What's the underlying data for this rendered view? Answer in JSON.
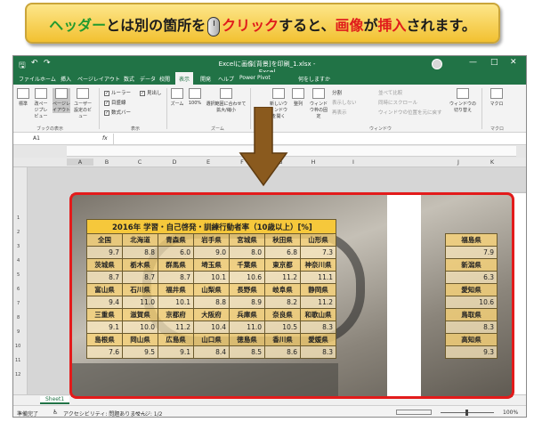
{
  "callout": {
    "part1": "ヘッダー",
    "part2": "とは別の箇所を",
    "part3": "クリック",
    "part4": "すると、",
    "part5": "画像",
    "part6": "が",
    "part7": "挿入",
    "part8": "されます。",
    "mouse_icon": "mouse-icon"
  },
  "window": {
    "title": "Excelに画像[背景]を印刷_1.xlsx - Excel",
    "qat": {
      "save": "🖫",
      "undo": "↶",
      "redo": "↷"
    },
    "controls": {
      "min": "—",
      "max": "□",
      "close": "✕"
    }
  },
  "tabs": [
    "ファイル",
    "ホーム",
    "挿入",
    "ページレイアウト",
    "数式",
    "データ",
    "校閲",
    "表示",
    "開発",
    "ヘルプ",
    "Power Pivot",
    "何をしますか"
  ],
  "active_tab_index": 7,
  "ribbon": {
    "view_buttons": [
      "標準",
      "改ページプレビュー",
      "ページレイアウト",
      "ユーザー設定のビュー"
    ],
    "group_book_views": "ブックの表示",
    "checks": [
      {
        "label": "ルーラー",
        "checked": true
      },
      {
        "label": "目盛線",
        "checked": true
      },
      {
        "label": "数式バー",
        "checked": true
      },
      {
        "label": "見出し",
        "checked": true
      }
    ],
    "group_show": "表示",
    "zoom_buttons": [
      "ズーム",
      "100%",
      "選択範囲に合わせて拡大/縮小"
    ],
    "group_zoom": "ズーム",
    "window_buttons": [
      "新しいウィンドウを開く",
      "整列",
      "ウィンドウ枠の固定"
    ],
    "window_small": [
      "分割",
      "表示しない",
      "再表示",
      "並べて比較",
      "同時にスクロール",
      "ウィンドウの位置を元に戻す"
    ],
    "switch_window": "ウィンドウの切り替え",
    "group_window": "ウィンドウ",
    "macro": "マクロ",
    "group_macro": "マクロ"
  },
  "formula_bar": {
    "cell_ref": "A1",
    "fx": "fx"
  },
  "columns": [
    "A",
    "B",
    "C",
    "D",
    "E",
    "F",
    "G",
    "H",
    "I",
    "J",
    "K"
  ],
  "rows": [
    "1",
    "2",
    "3",
    "4",
    "5",
    "6",
    "7",
    "8",
    "9",
    "10",
    "11",
    "12",
    "13",
    "14"
  ],
  "sheet_tab": "Sheet1",
  "status": {
    "ready": "準備完了",
    "accessibility": "アクセシビリティ: 問題ありません",
    "page": "ページ: 1/2",
    "zoom": "100%"
  },
  "table": {
    "title": "2016年 学習・自己啓発・訓練行動者率（10歳以上）[%]",
    "blocks": [
      {
        "prefs": [
          "全国",
          "北海道",
          "青森県",
          "岩手県",
          "宮城県",
          "秋田県",
          "山形県"
        ],
        "values": [
          "9.7",
          "8.8",
          "6.0",
          "9.0",
          "8.0",
          "6.8",
          "7.3"
        ]
      },
      {
        "prefs": [
          "茨城県",
          "栃木県",
          "群馬県",
          "埼玉県",
          "千葉県",
          "東京都",
          "神奈川県"
        ],
        "values": [
          "8.7",
          "8.7",
          "8.7",
          "10.1",
          "10.6",
          "11.2",
          "11.1"
        ]
      },
      {
        "prefs": [
          "富山県",
          "石川県",
          "福井県",
          "山梨県",
          "長野県",
          "岐阜県",
          "静岡県"
        ],
        "values": [
          "9.4",
          "11.0",
          "10.1",
          "8.8",
          "8.9",
          "8.2",
          "11.2"
        ]
      },
      {
        "prefs": [
          "三重県",
          "滋賀県",
          "京都府",
          "大阪府",
          "兵庫県",
          "奈良県",
          "和歌山県"
        ],
        "values": [
          "9.1",
          "10.0",
          "11.2",
          "10.4",
          "11.0",
          "10.5",
          "8.3"
        ]
      },
      {
        "prefs": [
          "島根県",
          "岡山県",
          "広島県",
          "山口県",
          "徳島県",
          "香川県",
          "愛媛県"
        ],
        "values": [
          "7.6",
          "9.5",
          "9.1",
          "8.4",
          "8.5",
          "8.6",
          "8.3"
        ]
      }
    ],
    "page2_blocks": [
      {
        "prefs": [
          "福島県"
        ],
        "values": [
          "7.9"
        ]
      },
      {
        "prefs": [
          "新潟県"
        ],
        "values": [
          "6.3"
        ]
      },
      {
        "prefs": [
          "愛知県"
        ],
        "values": [
          "10.6"
        ]
      },
      {
        "prefs": [
          "鳥取県"
        ],
        "values": [
          "8.3"
        ]
      },
      {
        "prefs": [
          "高知県"
        ],
        "values": [
          "9.3"
        ]
      }
    ]
  },
  "colors": {
    "excel_green": "#217346",
    "highlight_red": "#e31b1b",
    "callout_yellow": "#f2c131",
    "arrow_brown": "#8a5a1e"
  }
}
